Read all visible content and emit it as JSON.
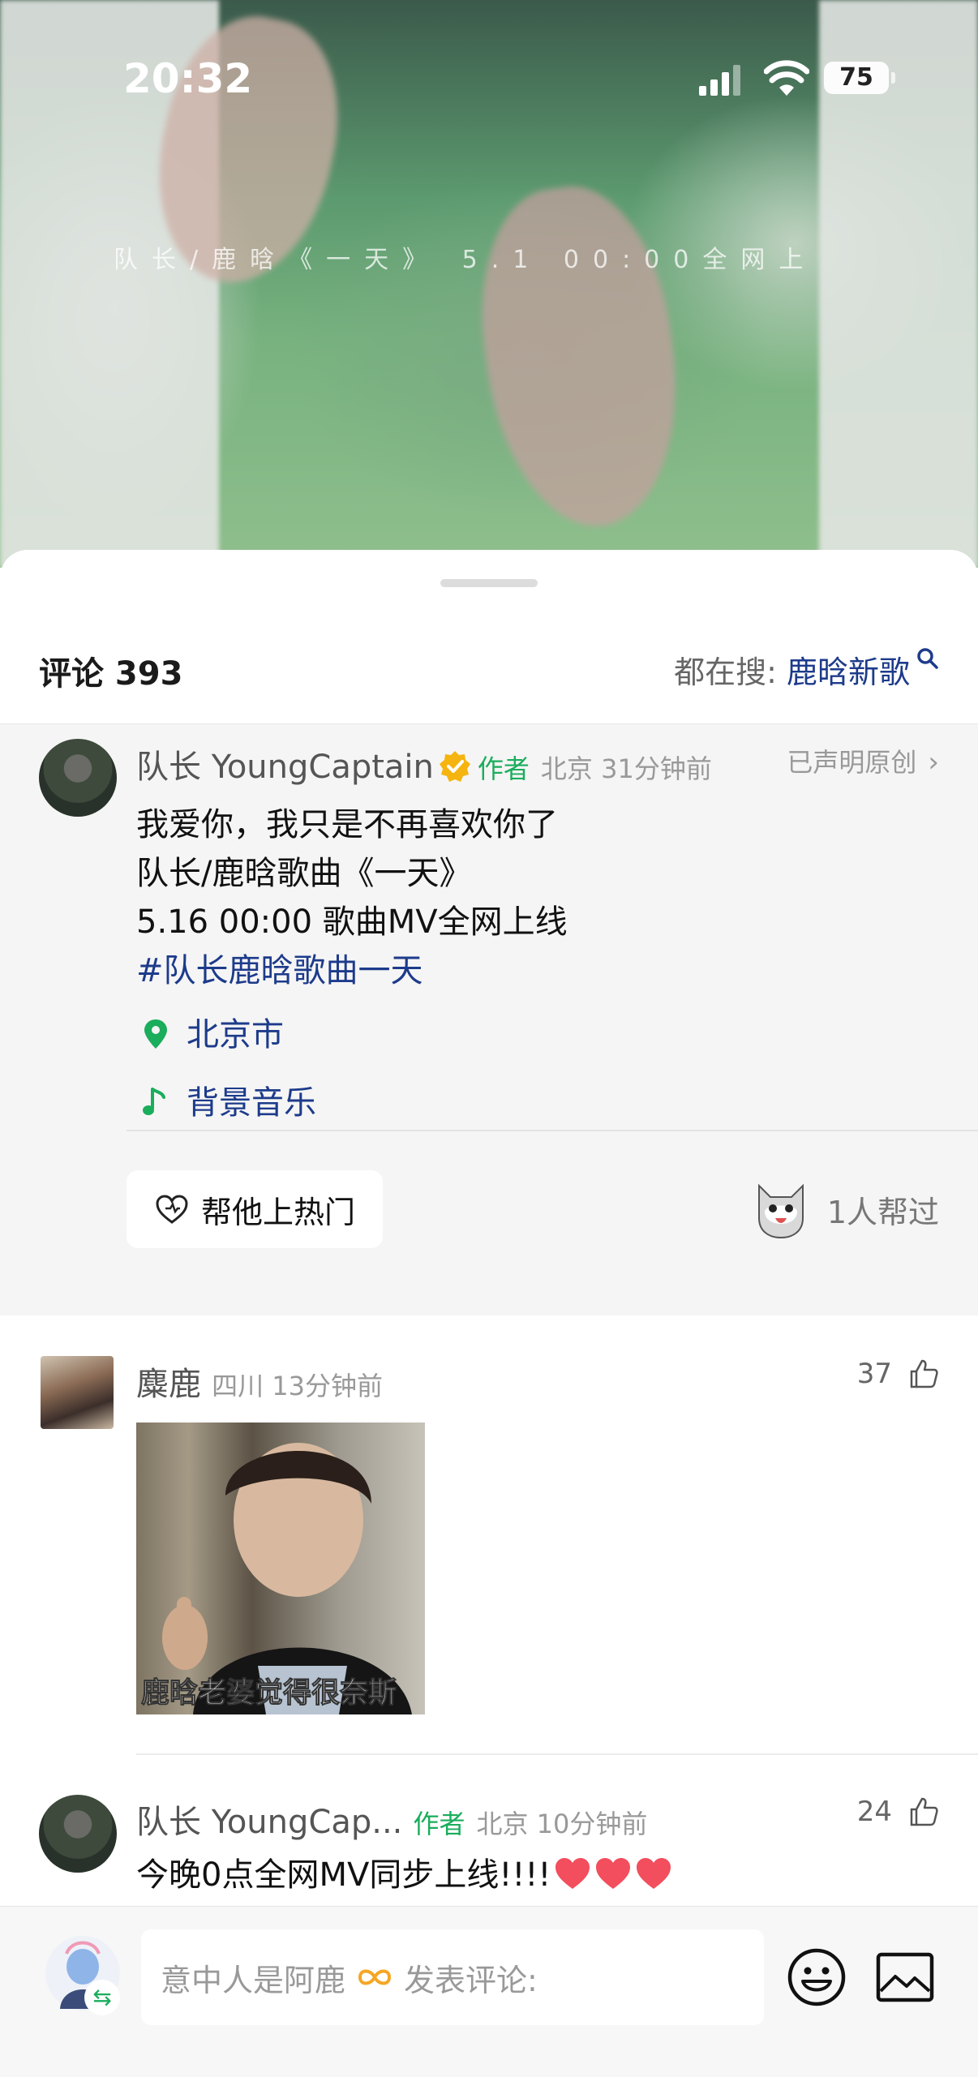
{
  "status_bar": {
    "time": "20:32",
    "battery": "75"
  },
  "video": {
    "subtitle": "队长/鹿晗《一天》 5.1 00:00全网上"
  },
  "header": {
    "comments_label": "评论 393",
    "trending_prefix": "都在搜: ",
    "trending_keyword": "鹿晗新歌"
  },
  "author_post": {
    "name": "队长 YoungCaptain",
    "author_tag": "作者",
    "location_time": "北京 31分钟前",
    "declared": "已声明原创",
    "lines": [
      "我爱你，我只是不再喜欢你了",
      "队长/鹿晗歌曲《一天》",
      "5.16 00:00 歌曲MV全网上线"
    ],
    "hashtag": "#队长鹿晗歌曲一天",
    "location": "北京市",
    "music": "背景音乐",
    "boost_button": "帮他上热门",
    "helpers": "1人帮过"
  },
  "comments": [
    {
      "name": "麋鹿",
      "meta": "四川 13分钟前",
      "likes": "37",
      "meme_caption": "鹿晗老婆觉得很奈斯"
    },
    {
      "name": "队长 YoungCap...",
      "author_tag": "作者",
      "meta": "北京 10分钟前",
      "likes": "24",
      "text": "今晚0点全网MV同步上线!!!!"
    }
  ],
  "bottom_bar": {
    "placeholder_left": "意中人是阿鹿",
    "placeholder_right": "发表评论:"
  },
  "colors": {
    "accent_green": "#1aad5c",
    "link_blue": "#1d3b8b",
    "heart_red": "#f24e5d"
  }
}
